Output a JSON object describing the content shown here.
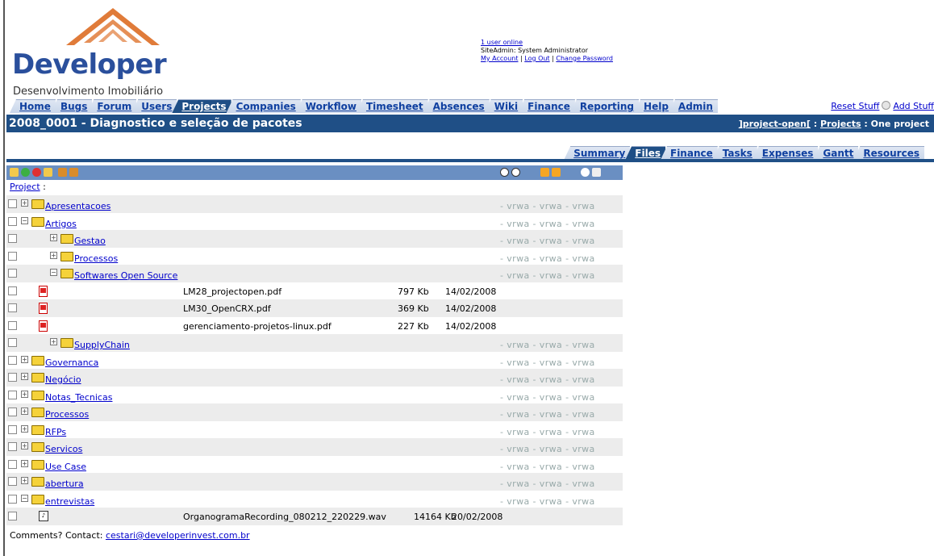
{
  "header": {
    "logo_word": "Developer",
    "logo_sub": "Desenvolvimento Imobiliário",
    "users_online": "1 user online",
    "site_admin": "SiteAdmin: System Administrator",
    "my_account": "My Account",
    "log_out": "Log Out",
    "change_password": "Change Password"
  },
  "nav": {
    "tabs": [
      "Home",
      "Bugs",
      "Forum",
      "Users",
      "Projects",
      "Companies",
      "Workflow",
      "Timesheet",
      "Absences",
      "Wiki",
      "Finance",
      "Reporting",
      "Help",
      "Admin"
    ],
    "active": "Projects",
    "reset_stuff": "Reset Stuff",
    "add_stuff": "Add Stuff"
  },
  "title": {
    "text": "2008_0001 - Diagnostico e seleção de pacotes",
    "crumb_home": "]project-open[",
    "crumb_sep": " : ",
    "crumb_projects": "Projects",
    "crumb_current": "One project"
  },
  "subtabs": {
    "tabs": [
      "Summary",
      "Files",
      "Finance",
      "Tasks",
      "Expenses",
      "Gantt",
      "Resources"
    ],
    "active": "Files"
  },
  "files": {
    "project_link": "Project",
    "project_suffix": " :",
    "perm": "- vrwa - vrwa - vrwa",
    "rows": [
      {
        "type": "folder",
        "indent": 0,
        "expanded": false,
        "name": "Apresentacoes"
      },
      {
        "type": "folder",
        "indent": 0,
        "expanded": true,
        "name": "Artigos"
      },
      {
        "type": "folder",
        "indent": 1,
        "expanded": false,
        "name": "Gestao"
      },
      {
        "type": "folder",
        "indent": 1,
        "expanded": false,
        "name": "Processos"
      },
      {
        "type": "folder",
        "indent": 1,
        "expanded": true,
        "name": "Softwares Open Source"
      },
      {
        "type": "pdf",
        "name": "LM28_projectopen.pdf",
        "size": "797 Kb",
        "date": "14/02/2008"
      },
      {
        "type": "pdf",
        "name": "LM30_OpenCRX.pdf",
        "size": "369 Kb",
        "date": "14/02/2008"
      },
      {
        "type": "pdf",
        "name": "gerenciamento-projetos-linux.pdf",
        "size": "227 Kb",
        "date": "14/02/2008"
      },
      {
        "type": "folder",
        "indent": 1,
        "expanded": false,
        "name": "SupplyChain"
      },
      {
        "type": "folder",
        "indent": 0,
        "expanded": false,
        "name": "Governanca"
      },
      {
        "type": "folder",
        "indent": 0,
        "expanded": false,
        "name": "Negócio"
      },
      {
        "type": "folder",
        "indent": 0,
        "expanded": false,
        "name": "Notas_Tecnicas"
      },
      {
        "type": "folder",
        "indent": 0,
        "expanded": false,
        "name": "Processos"
      },
      {
        "type": "folder",
        "indent": 0,
        "expanded": false,
        "name": "RFPs"
      },
      {
        "type": "folder",
        "indent": 0,
        "expanded": false,
        "name": "Servicos"
      },
      {
        "type": "folder",
        "indent": 0,
        "expanded": false,
        "name": "Use Case"
      },
      {
        "type": "folder",
        "indent": 0,
        "expanded": false,
        "name": "abertura"
      },
      {
        "type": "folder",
        "indent": 0,
        "expanded": true,
        "name": "entrevistas"
      },
      {
        "type": "wav",
        "name": "OrganogramaRecording_080212_220229.wav",
        "size": "14164 Kb",
        "date": "20/02/2008"
      }
    ]
  },
  "footer": {
    "label": "Comments? Contact: ",
    "email": "cestari@developerinvest.com.br"
  },
  "colors": {
    "brand": "#1f4f86",
    "link": "#0000cc",
    "folder": "#f5d23a"
  }
}
